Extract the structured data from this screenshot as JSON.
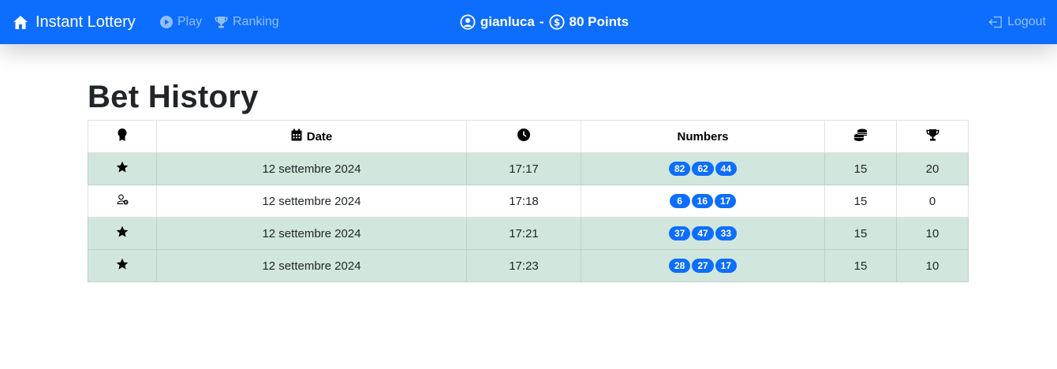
{
  "navbar": {
    "brand": "Instant Lottery",
    "play": "Play",
    "ranking": "Ranking",
    "username": "gianluca",
    "separator": "-",
    "points": "80 Points",
    "logout": "Logout"
  },
  "page": {
    "title": "Bet History"
  },
  "table": {
    "headers": {
      "status_icon": "award-icon",
      "date": "Date",
      "time_icon": "clock-icon",
      "numbers": "Numbers",
      "cost_icon": "coins-icon",
      "prize_icon": "trophy-icon"
    },
    "rows": [
      {
        "status": "win",
        "status_icon": "star-icon",
        "date": "12 settembre 2024",
        "time": "17:17",
        "numbers": [
          "82",
          "62",
          "44"
        ],
        "cost": "15",
        "prize": "20"
      },
      {
        "status": "lose",
        "status_icon": "person-x-icon",
        "date": "12 settembre 2024",
        "time": "17:18",
        "numbers": [
          "6",
          "16",
          "17"
        ],
        "cost": "15",
        "prize": "0"
      },
      {
        "status": "win",
        "status_icon": "star-icon",
        "date": "12 settembre 2024",
        "time": "17:21",
        "numbers": [
          "37",
          "47",
          "33"
        ],
        "cost": "15",
        "prize": "10"
      },
      {
        "status": "win",
        "status_icon": "star-icon",
        "date": "12 settembre 2024",
        "time": "17:23",
        "numbers": [
          "28",
          "27",
          "17"
        ],
        "cost": "15",
        "prize": "10"
      }
    ]
  },
  "colors": {
    "primary": "#0d6efd",
    "win_row": "#d1e7dd",
    "lose_row": "#ffffff",
    "badge": "#0d6efd"
  }
}
